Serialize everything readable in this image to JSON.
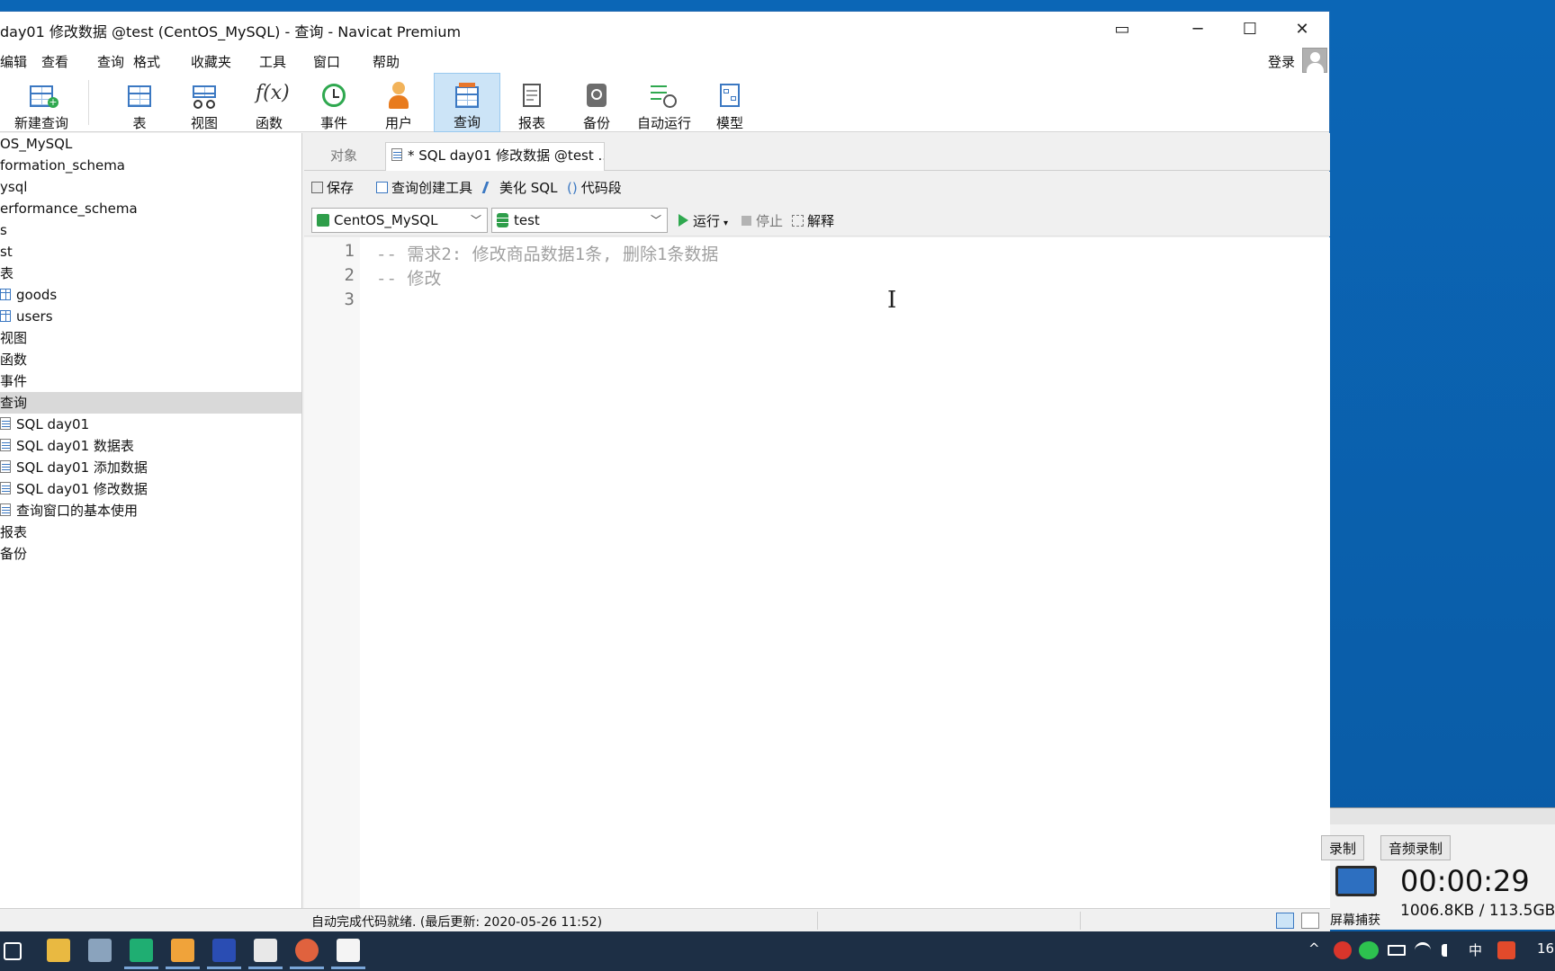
{
  "window": {
    "title": "day01 修改数据 @test (CentOS_MySQL) - 查询 - Navicat Premium",
    "controls": {
      "restore": "▭",
      "minimize": "─",
      "maximize": "☐",
      "close": "✕"
    }
  },
  "menu": {
    "items": [
      "编辑",
      "查看",
      "查询",
      "格式",
      "收藏夹",
      "工具",
      "窗口",
      "帮助"
    ],
    "login": "登录"
  },
  "toolbar": {
    "new_query": "新建查询",
    "tools": [
      "表",
      "视图",
      "函数",
      "事件",
      "用户",
      "查询",
      "报表",
      "备份",
      "自动运行",
      "模型"
    ]
  },
  "nav": {
    "items": [
      "OS_MySQL",
      "formation_schema",
      "ysql",
      "erformance_schema",
      "s",
      "st",
      "表",
      "goods",
      "users",
      "视图",
      "函数",
      "事件",
      "查询",
      "SQL day01",
      "SQL day01 数据表",
      "SQL day01 添加数据",
      "SQL day01 修改数据",
      "查询窗口的基本使用",
      "报表",
      "备份"
    ]
  },
  "tabs": {
    "objects": "对象",
    "query": "* SQL day01 修改数据 @test ..."
  },
  "query_toolbar": {
    "save": "保存",
    "builder": "查询创建工具",
    "beautify": "美化 SQL",
    "snippet": "代码段"
  },
  "selectors": {
    "connection": "CentOS_MySQL",
    "database": "test",
    "run": "运行",
    "stop": "停止",
    "explain": "解释"
  },
  "editor": {
    "line_numbers": [
      "1",
      "2",
      "3"
    ],
    "lines": [
      "-- 需求2: 修改商品数据1条, 删除1条数据",
      "-- 修改",
      ""
    ]
  },
  "status": {
    "text": "自动完成代码就绪. (最后更新: 2020-05-26 11:52)"
  },
  "recorder": {
    "tab1": "录制",
    "tab2": "音频录制",
    "time": "00:00:29",
    "size": "1006.8KB / 113.5GB",
    "capture": "屏幕捕获"
  },
  "tray": {
    "caret": "^",
    "ime": "中",
    "clock": "16"
  },
  "colors": {
    "accent": "#3b78c2",
    "run_green": "#2fa84f",
    "comment_gray": "#a0a0a0"
  }
}
